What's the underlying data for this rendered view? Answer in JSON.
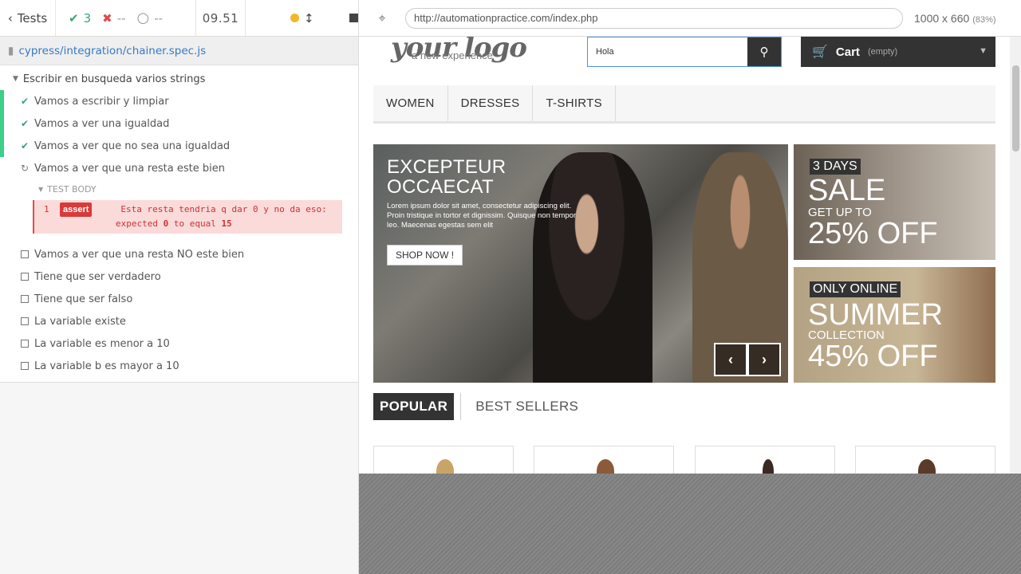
{
  "runner": {
    "tests_label": "Tests",
    "passed": "3",
    "failed": "--",
    "pending": "--",
    "duration": "09.51",
    "spec_file": "cypress/integration/chainer.spec.js",
    "suite_title": "Escribir en busqueda varios strings",
    "tests": [
      {
        "label": "Vamos a escribir y limpiar",
        "state": "passed"
      },
      {
        "label": "Vamos a ver una igualdad",
        "state": "passed"
      },
      {
        "label": "Vamos a ver que no sea una igualdad",
        "state": "passed"
      },
      {
        "label": "Vamos a ver que una resta este bien",
        "state": "running"
      },
      {
        "label": "Vamos a ver que una resta NO este bien",
        "state": "pending"
      },
      {
        "label": "Tiene que ser verdadero",
        "state": "pending"
      },
      {
        "label": "Tiene que ser falso",
        "state": "pending"
      },
      {
        "label": "La variable existe",
        "state": "pending"
      },
      {
        "label": "La variable es menor a 10",
        "state": "pending"
      },
      {
        "label": "La variable b es mayor a 10",
        "state": "pending"
      }
    ],
    "test_body_label": "TEST BODY",
    "command": {
      "number": "1",
      "name": "assert",
      "message_line1": "Esta resta tendria q dar 0 y no da eso:",
      "message_line2_pre": "expected",
      "expected": "0",
      "message_line2_mid": "to equal",
      "actual": "15"
    }
  },
  "aut": {
    "url": "http://automationpractice.com/index.php",
    "viewport": "1000 x 660",
    "scale": "(83%)",
    "logo_text": "your logo",
    "logo_sub": "a new experience",
    "search_value": "Hola",
    "cart_label": "Cart",
    "cart_status": "(empty)",
    "menu": [
      "WOMEN",
      "DRESSES",
      "T-SHIRTS"
    ],
    "hero": {
      "title_line1": "EXCEPTEUR",
      "title_line2": "OCCAECAT",
      "lead": "Lorem ipsum dolor sit amet, consectetur adipiscing elit. Proin tristique in tortor et dignissim. Quisque non tempor leo. Maecenas egestas sem elit",
      "button": "SHOP NOW !"
    },
    "promo1": {
      "tag": "3 DAYS",
      "big": "SALE",
      "mid": "GET UP TO",
      "big2": "25% OFF"
    },
    "promo2": {
      "tag": "ONLY ONLINE",
      "big": "SUMMER",
      "mid": "COLLECTION",
      "big2": "45% OFF"
    },
    "tabs": [
      "POPULAR",
      "BEST SELLERS"
    ]
  }
}
